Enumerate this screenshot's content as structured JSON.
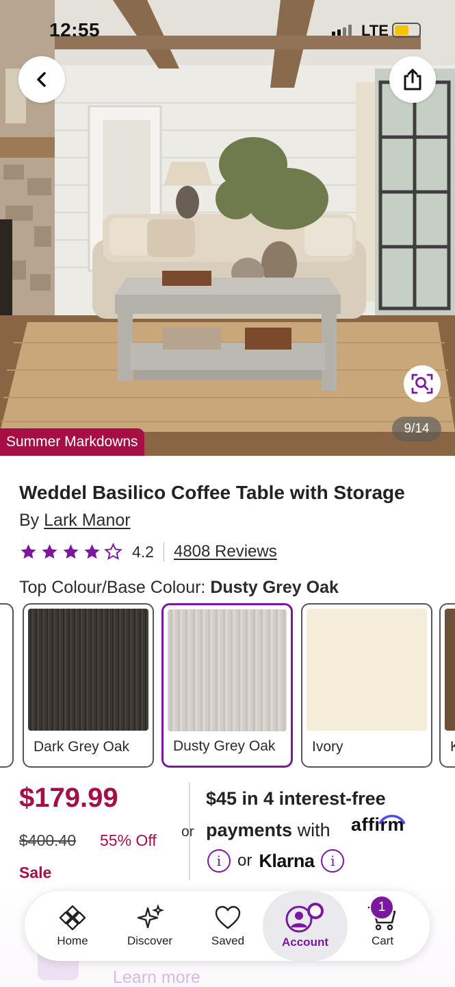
{
  "status_bar": {
    "time": "12:55",
    "network": "LTE"
  },
  "gallery": {
    "counter": "9/14",
    "promo_badge": "Summer Markdowns"
  },
  "product": {
    "title": "Weddel Basilico Coffee Table with Storage",
    "by_prefix": "By",
    "brand": "Lark Manor",
    "rating_value": "4.2",
    "rating_stars": 4.2,
    "reviews_link": "4808 Reviews",
    "colour_label": "Top Colour/Base Colour:",
    "colour_selected": "Dusty Grey Oak",
    "swatches": [
      {
        "label": "",
        "color": "#bdb8b2"
      },
      {
        "label": "Dark Grey Oak",
        "color": "#3a3633"
      },
      {
        "label": "Dusty Grey Oak",
        "color": "#cfcac5"
      },
      {
        "label": "Ivory",
        "color": "#f5ecd9"
      },
      {
        "label": "K",
        "color": "#6e5237"
      }
    ]
  },
  "pricing": {
    "price": "$179.99",
    "was_price": "$400.40",
    "discount": "55% Off",
    "sale_label": "Sale",
    "or_label": "or",
    "financing_line1": "$45 in 4 interest-free",
    "financing_payments": "payments",
    "financing_with": "with",
    "affirm_logo": "affirm",
    "klarna_or": "or",
    "klarna_logo": "Klarna"
  },
  "background_hint": {
    "learn_more": "Learn more"
  },
  "nav": {
    "home": "Home",
    "discover": "Discover",
    "saved": "Saved",
    "account": "Account",
    "cart": "Cart",
    "cart_count": "1"
  },
  "colors": {
    "brand_purple": "#7b189f",
    "sale_red": "#a50f45"
  },
  "icons": [
    "back-arrow-icon",
    "share-icon",
    "visual-search-icon",
    "star-icon",
    "info-icon",
    "home-icon",
    "discover-sparkle-icon",
    "heart-icon",
    "account-icon",
    "cart-icon"
  ]
}
